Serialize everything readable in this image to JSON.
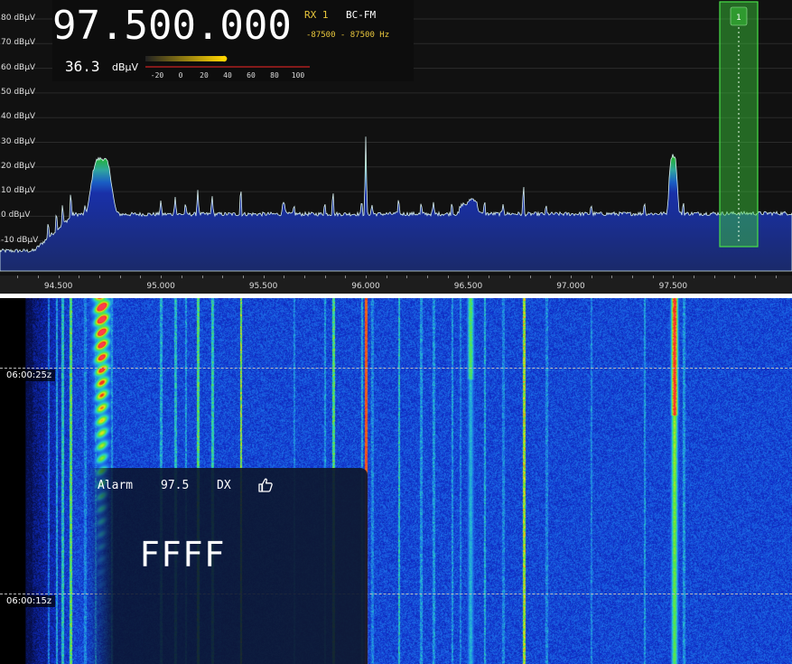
{
  "receiver": {
    "frequency": "97.500.000",
    "rx_label": "RX 1",
    "mode": "BC-FM",
    "bandwidth": "-87500 - 87500 Hz",
    "signal_value": "36.3",
    "signal_unit": "dBμV",
    "smeter_scale": [
      "-20",
      "0",
      "20",
      "40",
      "60",
      "80",
      "100"
    ],
    "smeter_level_dbuv": 36.3
  },
  "spectrum": {
    "y_axis_labels": [
      "80 dBμV",
      "70 dBμV",
      "60 dBμV",
      "50 dBμV",
      "40 dBμV",
      "30 dBμV",
      "20 dBμV",
      "10 dBμV",
      "0 dBμV",
      "-10 dBμV"
    ],
    "x_axis_labels": [
      "94.500",
      "95.000",
      "95.500",
      "96.000",
      "96.500",
      "97.000",
      "97.500"
    ],
    "vfo_marker_label": "1"
  },
  "waterfall": {
    "time_markers": [
      "06:00:25z",
      "06:00:15z"
    ]
  },
  "alarm": {
    "label": "Alarm",
    "frequency": "97.5",
    "type": "DX",
    "code": "FFFF",
    "thumb_icon": "thumbs-up-icon"
  },
  "colors": {
    "background": "#111111",
    "accent_yellow": "#e8c63c",
    "vfo_green": "#3cd23c",
    "noise_blue": "#0a23a0"
  }
}
